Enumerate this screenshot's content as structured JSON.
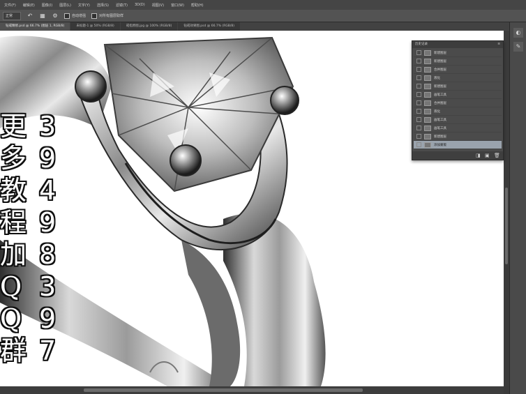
{
  "menu": {
    "items": [
      "文件(F)",
      "编辑(E)",
      "图像(I)",
      "图层(L)",
      "文字(Y)",
      "选择(S)",
      "滤镜(T)",
      "3D(D)",
      "视图(V)",
      "窗口(W)",
      "帮助(H)"
    ]
  },
  "options": {
    "mode_label": "正常",
    "icon_rotate": "↶",
    "icon_grid": "▦",
    "icon_gear": "⚙",
    "auto_label": "自动增强",
    "sample_label": "对所有图层取样"
  },
  "tabs": [
    "钻戒精修.psd @ 66.7% (图层 1, RGB/8)",
    "未标题-1 @ 50% (RGB/8)",
    "戒指原图.jpg @ 100% (RGB/8)",
    "钻戒效果图.psd @ 66.7% (RGB/8)"
  ],
  "overlay": {
    "left": [
      "更",
      "多",
      "教",
      "程",
      "加",
      "Q",
      "Q",
      "群"
    ],
    "right": [
      "3",
      "9",
      "4",
      "9",
      "8",
      "3",
      "9",
      "7"
    ]
  },
  "panel": {
    "title": "历史记录",
    "menu_icon": "≡",
    "rows": [
      "新建图层",
      "新建图层",
      "合并图层",
      "液化",
      "新建图层",
      "画笔工具",
      "合并图层",
      "液化",
      "画笔工具",
      "画笔工具",
      "新建图层",
      "添加蒙版"
    ],
    "selected_index": 11,
    "footer_icons": [
      "◨",
      "▣",
      "🗑"
    ]
  },
  "dock": {
    "icons": [
      "◐",
      "✎"
    ]
  },
  "colors": {
    "chrome": "#535353",
    "panel_bg": "#4b4b4b",
    "selected_row": "#9aa3ad",
    "canvas": "#ffffff"
  }
}
